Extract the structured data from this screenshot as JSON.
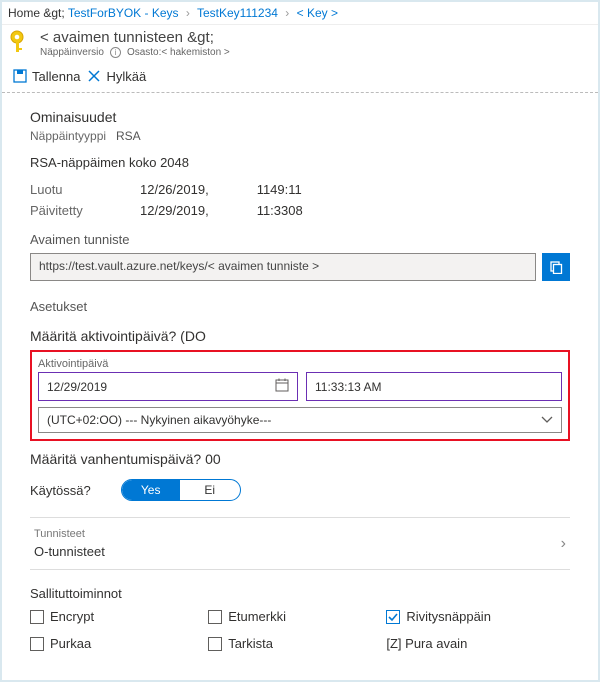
{
  "breadcrumb": {
    "home": "Home &gt;",
    "l1": "TestForBYOK - Keys",
    "l2": "TestKey111234",
    "l3": "< Key >"
  },
  "header": {
    "title": "< avaimen tunnisteen &gt;",
    "sub1": "Näppäinversio",
    "sub2": "Osasto:< hakemiston >"
  },
  "toolbar": {
    "save": "Tallenna",
    "discard": "Hylkää"
  },
  "props": {
    "section": "Ominaisuudet",
    "ktype_label": "Näppäintyyppi",
    "ktype": "RSA",
    "ksize": "RSA-näppäimen koko 2048",
    "created_label": "Luotu",
    "created_date": "12/26/2019,",
    "created_time": "1149:11",
    "updated_label": "Päivitetty",
    "updated_date": "12/29/2019,",
    "updated_time": "11:3308"
  },
  "identifier": {
    "label": "Avaimen tunniste",
    "value": "https://test.vault.azure.net/keys/< avaimen tunniste >"
  },
  "settings": {
    "section": "Asetukset",
    "activation_q": "Määritä aktivointipäivä? (DO",
    "activation_label": "Aktivointipäivä",
    "date": "12/29/2019",
    "time": "11:33:13 AM",
    "tz": "(UTC+02:OO) --- Nykyinen aikavyöhyke---",
    "expiration_q": "Määritä vanhentumispäivä? 00",
    "enabled_label": "Käytössä?",
    "yes": "Yes",
    "no": "Ei"
  },
  "tags": {
    "label": "Tunnisteet",
    "value": "O-tunnisteet"
  },
  "ops": {
    "title": "Sallituttoiminnot",
    "encrypt": "Encrypt",
    "sign": "Etumerkki",
    "wrap": "Rivitysnäppäin",
    "decrypt": "Purkaa",
    "verify": "Tarkista",
    "unwrap": "[Z] Pura avain"
  }
}
